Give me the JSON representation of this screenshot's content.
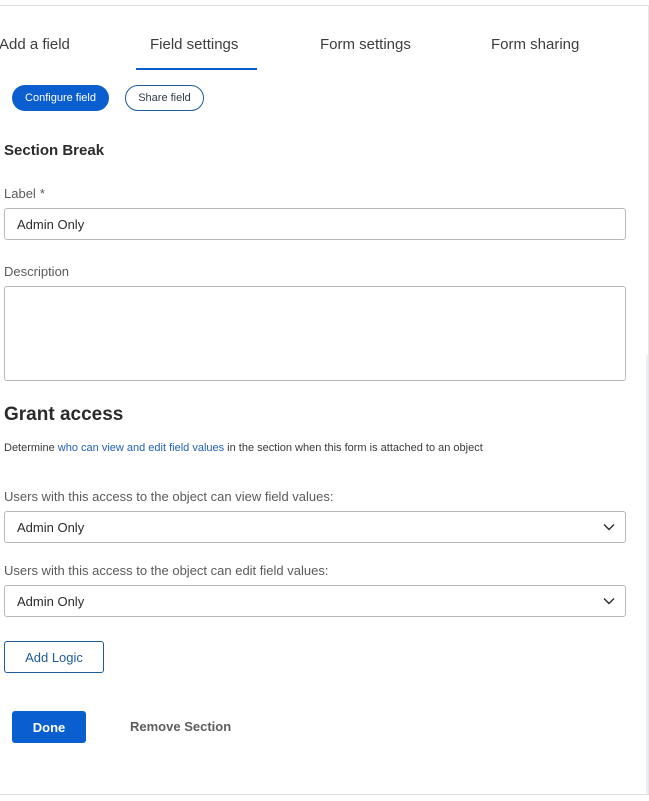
{
  "tabs": [
    {
      "label": "Add a field"
    },
    {
      "label": "Field settings"
    },
    {
      "label": "Form settings"
    },
    {
      "label": "Form sharing"
    }
  ],
  "active_tab": "Field settings",
  "pills": {
    "configure": "Configure field",
    "share": "Share field"
  },
  "section": {
    "title": "Section Break"
  },
  "label_field": {
    "label": "Label",
    "required_marker": "*",
    "value": "Admin Only"
  },
  "description_field": {
    "label": "Description",
    "value": ""
  },
  "grant_access": {
    "heading": "Grant access",
    "desc_prefix": "Determine ",
    "desc_link": "who can view and edit field values",
    "desc_suffix": " in the section when this form is attached to an object",
    "view_label": "Users with this access to the object can view field values:",
    "view_value": "Admin Only",
    "edit_label": "Users with this access to the object can edit field values:",
    "edit_value": "Admin Only"
  },
  "buttons": {
    "add_logic": "Add Logic",
    "done": "Done",
    "remove_section": "Remove Section"
  },
  "colors": {
    "accent": "#0b5ecf",
    "link": "#1f62b3"
  },
  "icons": {
    "select_chevron": "chevron-down-icon"
  }
}
